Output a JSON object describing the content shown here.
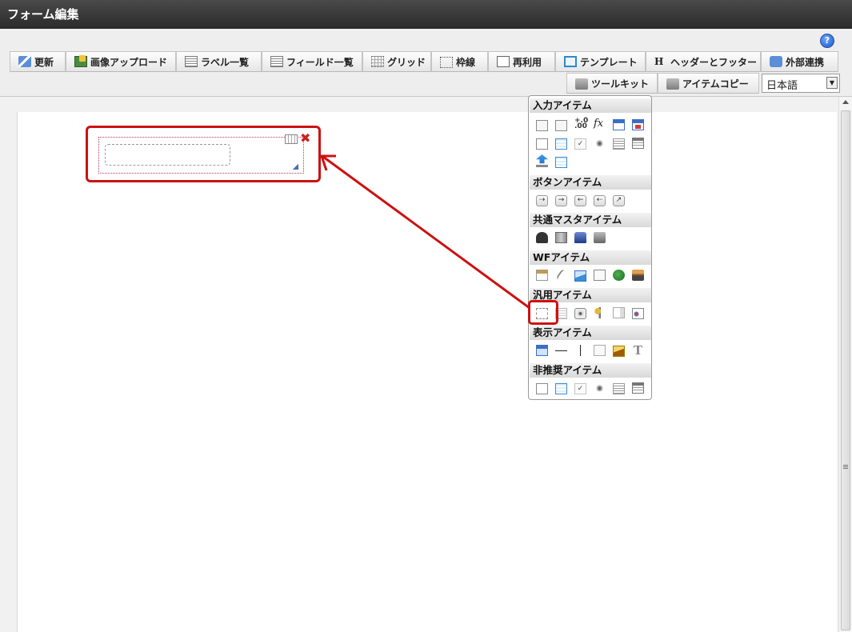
{
  "window": {
    "title": "フォーム編集"
  },
  "toolbar": {
    "help_icon": "help-icon",
    "buttons": [
      {
        "label": "更新",
        "icon": "update-icon"
      },
      {
        "label": "画像アップロード",
        "icon": "image-upload-icon"
      },
      {
        "label": "ラベル一覧",
        "icon": "label-list-icon"
      },
      {
        "label": "フィールド一覧",
        "icon": "field-list-icon"
      },
      {
        "label": "グリッド",
        "icon": "grid-icon"
      },
      {
        "label": "枠線",
        "icon": "border-icon"
      },
      {
        "label": "再利用",
        "icon": "reuse-icon"
      },
      {
        "label": "テンプレート",
        "icon": "template-icon"
      },
      {
        "label": "ヘッダーとフッター",
        "icon": "header-footer-icon"
      },
      {
        "label": "外部連携",
        "icon": "external-link-icon"
      },
      {
        "label": "ツールキット",
        "icon": "toolkit-icon"
      },
      {
        "label": "アイテムコピー",
        "icon": "item-copy-icon"
      }
    ],
    "language": {
      "selected": "日本語"
    }
  },
  "palette": {
    "sections": [
      {
        "title": "入力アイテム"
      },
      {
        "title": "ボタンアイテム"
      },
      {
        "title": "共通マスタアイテム"
      },
      {
        "title": "WFアイテム"
      },
      {
        "title": "汎用アイテム"
      },
      {
        "title": "表示アイテム"
      },
      {
        "title": "非推奨アイテム"
      }
    ],
    "number_icon_text": "+.0\n.00",
    "fx_icon_text": "fx",
    "text_icon_text": "T"
  }
}
